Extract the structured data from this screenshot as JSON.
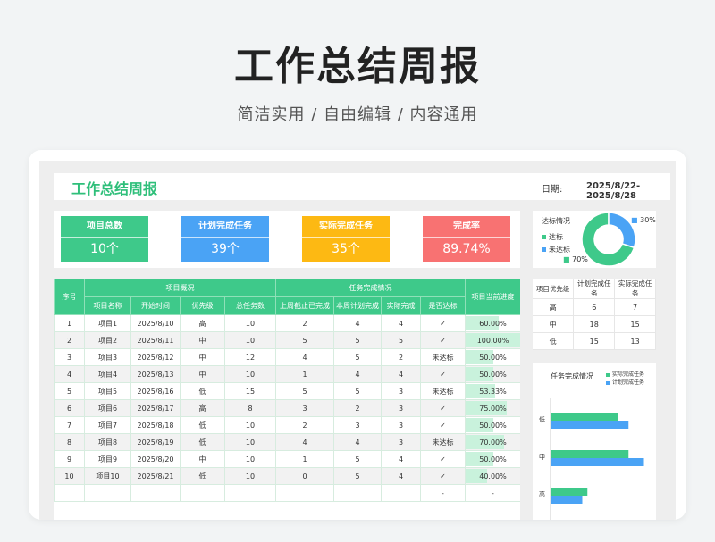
{
  "hero": {
    "title": "工作总结周报",
    "subtitle": "简洁实用 / 自由编辑 / 内容通用"
  },
  "sheet": {
    "title": "工作总结周报",
    "date_label": "日期:",
    "date_value": "2025/8/22-2025/8/28"
  },
  "kpis": [
    {
      "label": "项目总数",
      "value": "10个",
      "color": "#3ec98a"
    },
    {
      "label": "计划完成任务",
      "value": "39个",
      "color": "#4aa3f5"
    },
    {
      "label": "实际完成任务",
      "value": "35个",
      "color": "#fdb913"
    },
    {
      "label": "完成率",
      "value": "89.74%",
      "color": "#f87272"
    }
  ],
  "donut": {
    "title": "达标情况",
    "legend": [
      "达标",
      "未达标"
    ],
    "label_up": "30%",
    "label_down": "70%"
  },
  "chart_data": [
    {
      "type": "pie",
      "title": "达标情况",
      "categories": [
        "达标",
        "未达标"
      ],
      "values": [
        70,
        30
      ],
      "colors": [
        "#3ec98a",
        "#4aa3f5"
      ]
    },
    {
      "type": "bar",
      "title": "任务完成情况",
      "categories": [
        "低",
        "中",
        "高"
      ],
      "series": [
        {
          "name": "实际完成任务",
          "values": [
            13,
            15,
            7
          ],
          "color": "#3ec98a"
        },
        {
          "name": "计划完成任务",
          "values": [
            15,
            18,
            6
          ],
          "color": "#4aa3f5"
        }
      ]
    }
  ],
  "table": {
    "group_headers": {
      "seq": "序号",
      "overview": "项目概况",
      "status": "任务完成情况",
      "progress": "项目当前进度"
    },
    "columns": [
      "项目名称",
      "开始时间",
      "优先级",
      "总任务数",
      "上周截止已完成",
      "本周计划完成",
      "实际完成",
      "是否达标"
    ],
    "rows": [
      {
        "seq": "1",
        "name": "项目1",
        "start": "2025/8/10",
        "priority": "高",
        "total": "10",
        "last": "2",
        "plan": "4",
        "actual": "4",
        "ok": "✓",
        "progress": "60.00%",
        "pct": 60
      },
      {
        "seq": "2",
        "name": "项目2",
        "start": "2025/8/11",
        "priority": "中",
        "total": "10",
        "last": "5",
        "plan": "5",
        "actual": "5",
        "ok": "✓",
        "progress": "100.00%",
        "pct": 100
      },
      {
        "seq": "3",
        "name": "项目3",
        "start": "2025/8/12",
        "priority": "中",
        "total": "12",
        "last": "4",
        "plan": "5",
        "actual": "2",
        "ok": "未达标",
        "progress": "50.00%",
        "pct": 50
      },
      {
        "seq": "4",
        "name": "项目4",
        "start": "2025/8/13",
        "priority": "中",
        "total": "10",
        "last": "1",
        "plan": "4",
        "actual": "4",
        "ok": "✓",
        "progress": "50.00%",
        "pct": 50
      },
      {
        "seq": "5",
        "name": "项目5",
        "start": "2025/8/16",
        "priority": "低",
        "total": "15",
        "last": "5",
        "plan": "5",
        "actual": "3",
        "ok": "未达标",
        "progress": "53.33%",
        "pct": 53.33
      },
      {
        "seq": "6",
        "name": "项目6",
        "start": "2025/8/17",
        "priority": "高",
        "total": "8",
        "last": "3",
        "plan": "2",
        "actual": "3",
        "ok": "✓",
        "progress": "75.00%",
        "pct": 75
      },
      {
        "seq": "7",
        "name": "项目7",
        "start": "2025/8/18",
        "priority": "低",
        "total": "10",
        "last": "2",
        "plan": "3",
        "actual": "3",
        "ok": "✓",
        "progress": "50.00%",
        "pct": 50
      },
      {
        "seq": "8",
        "name": "项目8",
        "start": "2025/8/19",
        "priority": "低",
        "total": "10",
        "last": "4",
        "plan": "4",
        "actual": "3",
        "ok": "未达标",
        "progress": "70.00%",
        "pct": 70
      },
      {
        "seq": "9",
        "name": "项目9",
        "start": "2025/8/20",
        "priority": "中",
        "total": "10",
        "last": "1",
        "plan": "5",
        "actual": "4",
        "ok": "✓",
        "progress": "50.00%",
        "pct": 50
      },
      {
        "seq": "10",
        "name": "项目10",
        "start": "2025/8/21",
        "priority": "低",
        "total": "10",
        "last": "0",
        "plan": "5",
        "actual": "4",
        "ok": "✓",
        "progress": "40.00%",
        "pct": 40
      },
      {
        "seq": "",
        "name": "",
        "start": "",
        "priority": "",
        "total": "",
        "last": "",
        "plan": "",
        "actual": "",
        "ok": "-",
        "progress": "-",
        "pct": 0
      }
    ]
  },
  "priority_table": {
    "headers": [
      "项目优先级",
      "计划完成任务",
      "实际完成任务"
    ],
    "rows": [
      [
        "高",
        "6",
        "7"
      ],
      [
        "中",
        "18",
        "15"
      ],
      [
        "低",
        "15",
        "13"
      ]
    ]
  }
}
